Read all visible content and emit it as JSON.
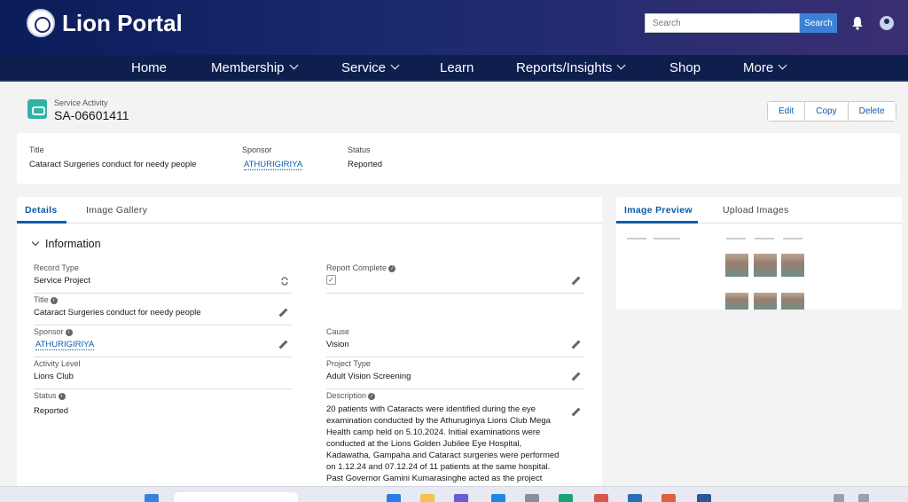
{
  "app": {
    "brand": "Lion Portal"
  },
  "search": {
    "placeholder": "Search",
    "button": "Search"
  },
  "nav": [
    {
      "label": "Home"
    },
    {
      "label": "Membership"
    },
    {
      "label": "Service"
    },
    {
      "label": "Learn"
    },
    {
      "label": "Reports/Insights"
    },
    {
      "label": "Shop"
    },
    {
      "label": "More"
    }
  ],
  "record": {
    "object_type": "Service Activity",
    "name": "SA-06601411"
  },
  "actions": {
    "edit": "Edit",
    "copy": "Copy",
    "delete": "Delete"
  },
  "highlights": {
    "title_label": "Title",
    "title_value": "Cataract Surgeries conduct for needy people",
    "sponsor_label": "Sponsor",
    "sponsor_value": "ATHURIGIRIYA",
    "status_label": "Status",
    "status_value": "Reported"
  },
  "tabs": {
    "details": "Details",
    "gallery": "Image Gallery"
  },
  "section": {
    "title": "Information"
  },
  "fields": {
    "record_type": {
      "label": "Record Type",
      "value": "Service Project"
    },
    "report_complete": {
      "label": "Report Complete",
      "checked": "✓"
    },
    "title": {
      "label": "Title",
      "value": "Cataract Surgeries conduct for needy people"
    },
    "sponsor": {
      "label": "Sponsor",
      "value": "ATHURIGIRIYA"
    },
    "cause": {
      "label": "Cause",
      "value": "Vision"
    },
    "activity_level": {
      "label": "Activity Level",
      "value": "Lions Club"
    },
    "project_type": {
      "label": "Project Type",
      "value": "Adult Vision Screening"
    },
    "status": {
      "label": "Status",
      "value": "Reported"
    },
    "description": {
      "label": "Description",
      "value": "20 patients with Cataracts were identified during the eye examination conducted by the Athurugiriya Lions Club Mega Health camp held on 5.10.2024. Initial examinations were conducted at the Lions Golden Jubilee Eye Hospital, Kadawatha, Gampaha and Cataract surgeries were performed on 1.12.24 and 07.12.24 of 11 patients at the same hospital. Past Governor Gamini Kumarasinghe acted as the project chairman and all the"
    }
  },
  "preview": {
    "tab_preview": "Image Preview",
    "tab_upload": "Upload Images"
  },
  "icons": {
    "logo": "lions-emblem-icon",
    "bell": "bell-icon",
    "user": "user-avatar-icon",
    "service": "handshake-icon"
  },
  "colors": {
    "header": "#0b1c5a",
    "nav": "#0e1f4e",
    "link": "#0b5cab",
    "accent": "#2fb3a6",
    "search_button": "#3b82d6"
  }
}
